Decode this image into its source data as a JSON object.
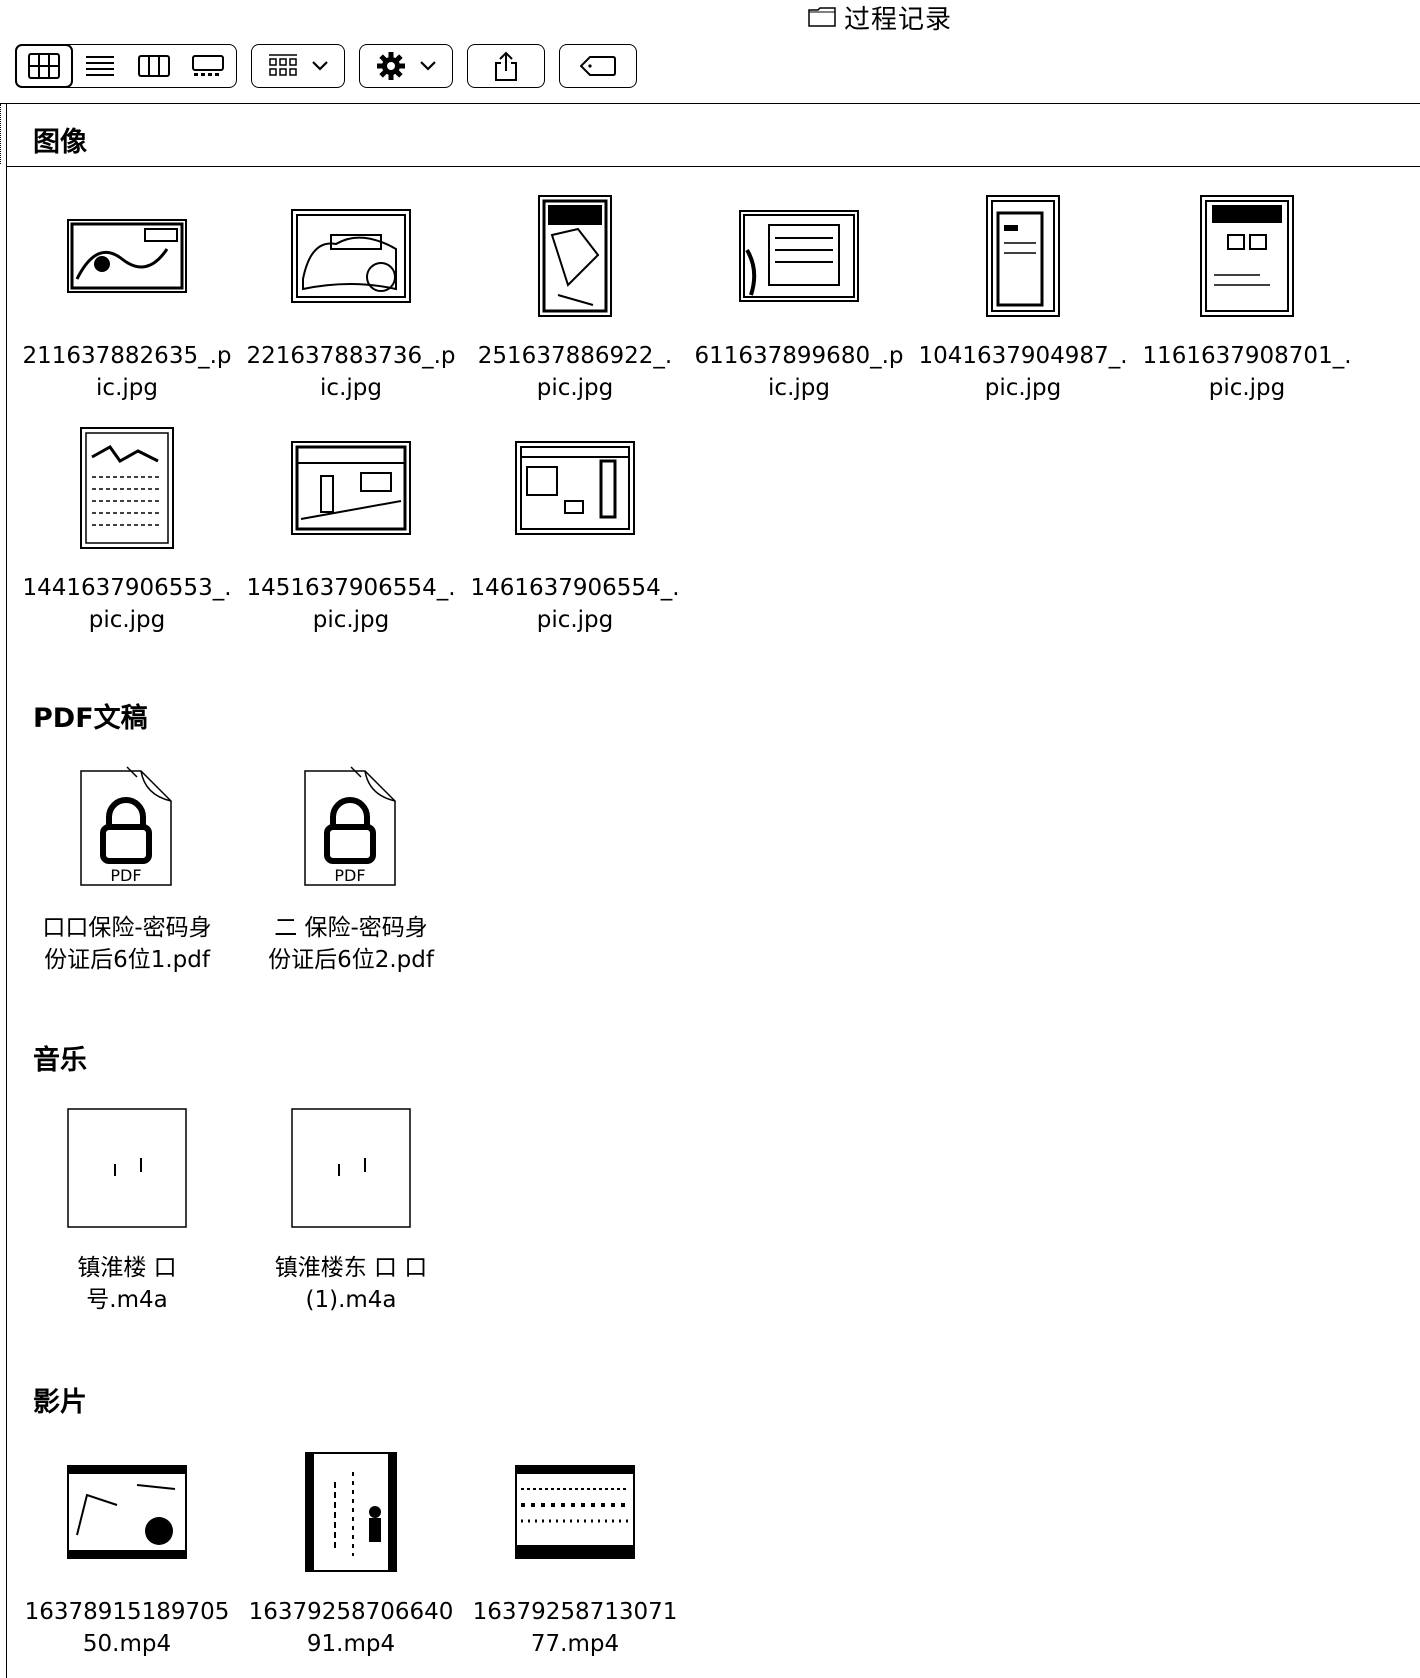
{
  "window": {
    "title": "过程记录",
    "title_icon": "folder-icon"
  },
  "toolbar": {
    "view_modes": [
      {
        "name": "icon-view",
        "icon": "grid-icon",
        "active": true
      },
      {
        "name": "list-view",
        "icon": "list-icon",
        "active": false
      },
      {
        "name": "column-view",
        "icon": "columns-icon",
        "active": false
      },
      {
        "name": "gallery-view",
        "icon": "gallery-icon",
        "active": false
      }
    ],
    "group_by": {
      "icon": "group-grid-icon",
      "chevron": "chevron-down-icon"
    },
    "action": {
      "icon": "gear-icon",
      "chevron": "chevron-down-icon"
    },
    "share": {
      "icon": "share-icon"
    },
    "tag": {
      "icon": "tag-icon"
    }
  },
  "sections": [
    {
      "title": "图像",
      "items": [
        {
          "label": "211637882635_.p\nic.jpg",
          "kind": "image-landscape"
        },
        {
          "label": "221637883736_.p\nic.jpg",
          "kind": "image-landscape"
        },
        {
          "label": "251637886922_.\npic.jpg",
          "kind": "image-portrait"
        },
        {
          "label": "611637899680_.p\nic.jpg",
          "kind": "image-landscape"
        },
        {
          "label": "1041637904987_.\npic.jpg",
          "kind": "image-portrait"
        },
        {
          "label": "1161637908701_.\npic.jpg",
          "kind": "image-portrait"
        },
        {
          "label": "1441637906553_.\npic.jpg",
          "kind": "image-portrait"
        },
        {
          "label": "1451637906554_.\npic.jpg",
          "kind": "image-landscape"
        },
        {
          "label": "1461637906554_.\npic.jpg",
          "kind": "image-landscape"
        }
      ]
    },
    {
      "title": "PDF文稿",
      "items": [
        {
          "label": "口口保险-密码身\n份证后6位1.pdf",
          "kind": "pdf-locked",
          "badge": "PDF"
        },
        {
          "label": "二 保险-密码身\n份证后6位2.pdf",
          "kind": "pdf-locked",
          "badge": "PDF"
        }
      ]
    },
    {
      "title": "音乐",
      "items": [
        {
          "label": "镇淮楼 口\n号.m4a",
          "kind": "audio"
        },
        {
          "label": "镇淮楼东 口 口\n(1).m4a",
          "kind": "audio"
        }
      ]
    },
    {
      "title": "影片",
      "items": [
        {
          "label": "16378915189705\n50.mp4",
          "kind": "video-landscape"
        },
        {
          "label": "16379258706640\n91.mp4",
          "kind": "video-portrait"
        },
        {
          "label": "16379258713071\n77.mp4",
          "kind": "video-landscape"
        }
      ]
    }
  ]
}
